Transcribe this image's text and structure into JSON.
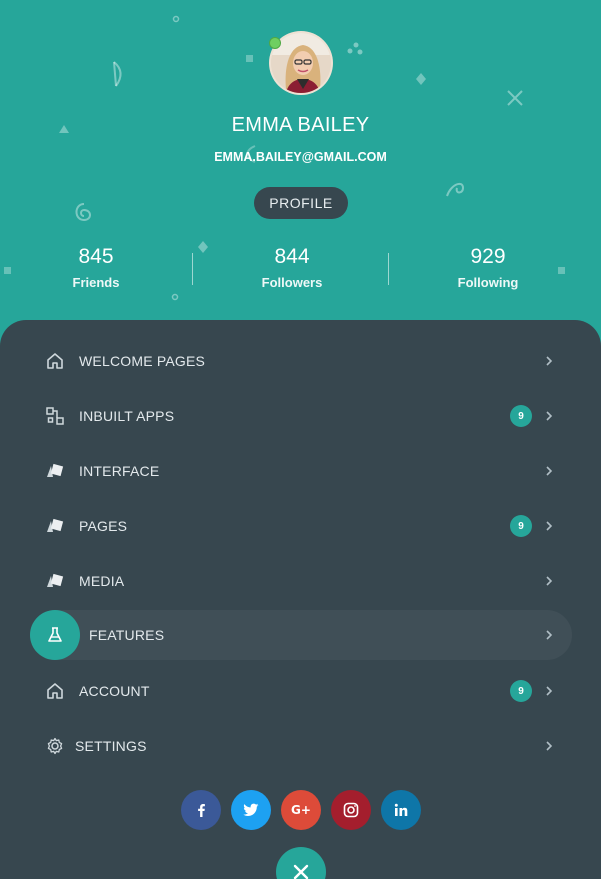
{
  "profile": {
    "name": "EMMA BAILEY",
    "email": "EMMA.BAILEY@GMAIL.COM",
    "profile_button": "PROFILE",
    "status": "online"
  },
  "stats": [
    {
      "value": "845",
      "label": "Friends"
    },
    {
      "value": "844",
      "label": "Followers"
    },
    {
      "value": "929",
      "label": "Following"
    }
  ],
  "menu": [
    {
      "label": "WELCOME PAGES",
      "icon": "home-icon",
      "badge": null
    },
    {
      "label": "INBUILT APPS",
      "icon": "apps-icon",
      "badge": "9"
    },
    {
      "label": "INTERFACE",
      "icon": "layers-icon",
      "badge": null
    },
    {
      "label": "PAGES",
      "icon": "layers-icon",
      "badge": "9"
    },
    {
      "label": "MEDIA",
      "icon": "layers-icon",
      "badge": null
    },
    {
      "label": "FEATURES",
      "icon": "flask-icon",
      "badge": null,
      "active": true
    },
    {
      "label": "ACCOUNT",
      "icon": "home-icon",
      "badge": "9"
    },
    {
      "label": "SETTINGS",
      "icon": "gear-icon",
      "badge": null
    }
  ],
  "social": [
    {
      "name": "facebook",
      "glyph": "f",
      "color": "#3b5998"
    },
    {
      "name": "twitter",
      "glyph": "t",
      "color": "#1da1f2"
    },
    {
      "name": "google-plus",
      "glyph": "G+",
      "color": "#dd4b39"
    },
    {
      "name": "instagram",
      "glyph": "ig",
      "color": "#a41e2d"
    },
    {
      "name": "linkedin",
      "glyph": "in",
      "color": "#0e76a8"
    }
  ],
  "colors": {
    "header_bg": "#26a69a",
    "panel_bg": "#37474f",
    "accent": "#26a69a",
    "active_row": "#404f57"
  }
}
